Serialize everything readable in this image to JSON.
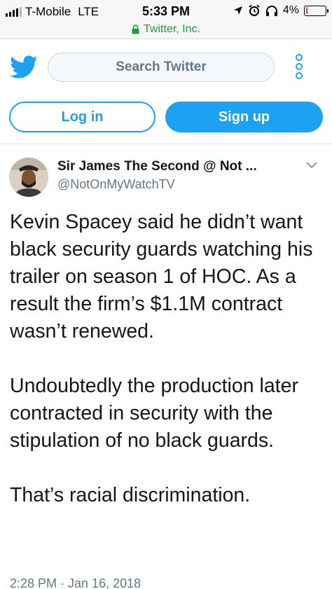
{
  "status_bar": {
    "carrier": "T-Mobile",
    "network": "LTE",
    "time": "5:33 PM",
    "battery": "4%",
    "battery_level": 0.04,
    "icons": [
      "location-arrow-icon",
      "alarm-icon",
      "headphones-icon"
    ]
  },
  "url_bar": {
    "site": "Twitter, Inc.",
    "lock_icon": "lock-icon"
  },
  "header": {
    "logo_icon": "twitter-bird-icon",
    "search_label": "Search Twitter",
    "more_icon": "more-vertical-icon"
  },
  "auth": {
    "login_label": "Log in",
    "signup_label": "Sign up"
  },
  "tweet": {
    "author_name": "Sir James The Second @ Not ...",
    "author_handle": "@NotOnMyWatchTV",
    "paragraphs": [
      "Kevin Spacey said he didn’t want black security guards watching his trailer on season 1 of HOC. As a result the firm’s $1.1M contract wasn’t renewed.",
      "Undoubtedly the production later contracted in security with the stipulation of no black guards.",
      "That’s racial discrimination."
    ],
    "timestamp": "2:28 PM · Jan 16, 2018"
  },
  "colors": {
    "brand": "#1da1f2",
    "text": "#14171a",
    "secondary": "#657786",
    "secure": "#1a9e40"
  }
}
